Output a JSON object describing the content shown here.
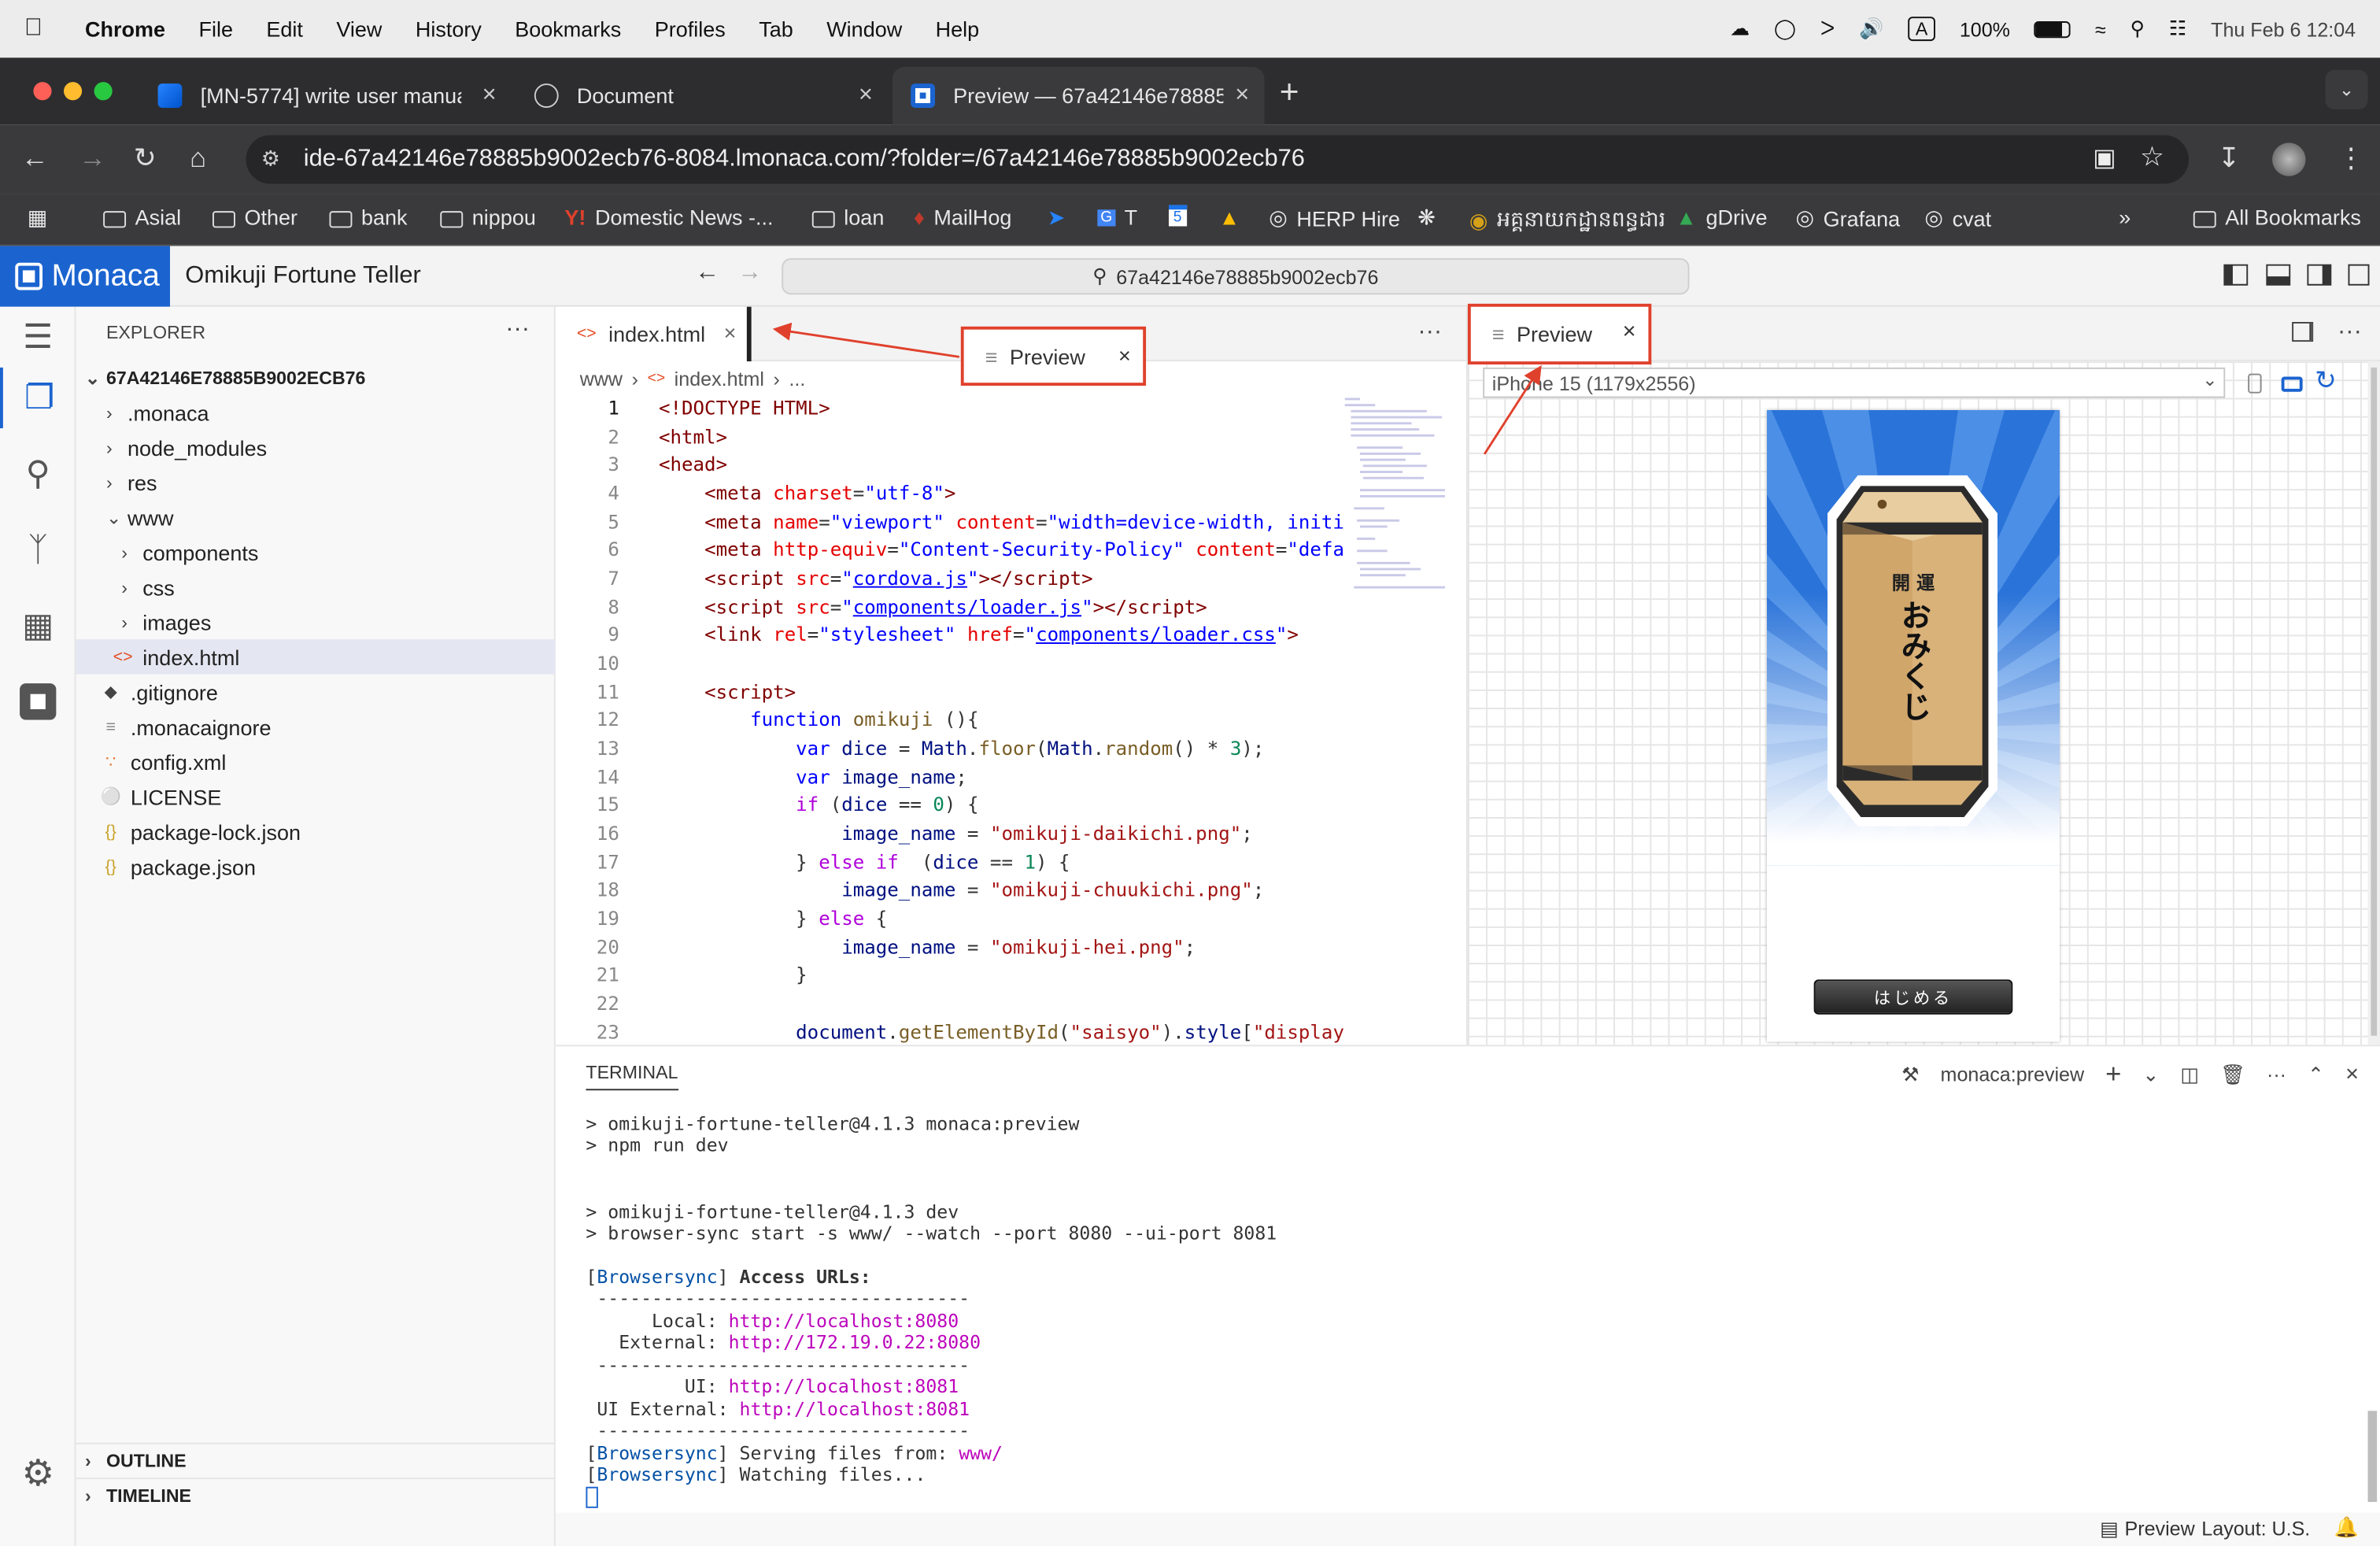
{
  "menubar": {
    "apple_icon": "apple-icon",
    "app": "Chrome",
    "items": [
      "File",
      "Edit",
      "View",
      "History",
      "Bookmarks",
      "Profiles",
      "Tab",
      "Window",
      "Help"
    ],
    "battery": "100%",
    "datetime": "Thu Feb 6  12:04"
  },
  "tabs": [
    {
      "title": "[MN-5774] write user manual",
      "favicon": "jira-icon",
      "active": false
    },
    {
      "title": "Document",
      "favicon": "globe-icon",
      "active": false
    },
    {
      "title": "Preview — 67a42146e78885b",
      "favicon": "monaca-icon",
      "active": true
    }
  ],
  "address": {
    "url": "ide-67a42146e78885b9002ecb76-8084.lmonaca.com/?folder=/67a42146e78885b9002ecb76"
  },
  "bookmarks": {
    "items": [
      "Asial",
      "Other",
      "bank",
      "nippou",
      "Domestic News -...",
      "loan",
      "MailHog",
      "T",
      "HERP Hire",
      "អគ្គនាយកដ្ឋានពន្ធដារ",
      "gDrive",
      "Grafana",
      "cvat"
    ],
    "more": "»",
    "all": "All Bookmarks"
  },
  "ide": {
    "logo": "Monaca",
    "project": "Omikuji Fortune Teller",
    "command_center": "67a42146e78885b9002ecb76"
  },
  "explorer": {
    "title": "EXPLORER",
    "root": "67A42146E78885B9002ECB76",
    "items": [
      ".monaca",
      "node_modules",
      "res",
      "www",
      "components",
      "css",
      "images",
      "index.html",
      ".gitignore",
      ".monacaignore",
      "config.xml",
      "LICENSE",
      "package-lock.json",
      "package.json"
    ],
    "outline": "OUTLINE",
    "timeline": "TIMELINE"
  },
  "editor": {
    "tab": "index.html",
    "breadcrumb": [
      "www",
      "index.html",
      "..."
    ],
    "line_numbers": [
      "1",
      "2",
      "3",
      "4",
      "5",
      "6",
      "7",
      "8",
      "9",
      "10",
      "11",
      "12",
      "13",
      "14",
      "15",
      "16",
      "17",
      "18",
      "19",
      "20",
      "21",
      "22",
      "23"
    ]
  },
  "annotation": {
    "floating_tab": "Preview"
  },
  "preview": {
    "tab": "Preview",
    "device": "iPhone 15 (1179x2556)",
    "box_top": "開 運",
    "box_main": "おみくじ",
    "start_button": "はじめる"
  },
  "terminal": {
    "title": "TERMINAL",
    "task": "monaca:preview",
    "l1": "> omikuji-fortune-teller@4.1.3 monaca:preview",
    "l2": "> npm run dev",
    "l3": "> omikuji-fortune-teller@4.1.3 dev",
    "l4": "> browser-sync start -s www/ --watch --port 8080 --ui-port 8081",
    "bs": "Browsersync",
    "access": "Access URLs:",
    "rule": " ----------------------------------",
    "local_label": "      Local: ",
    "local_url": "http://localhost:8080",
    "ext_label": "   External: ",
    "ext_url": "http://172.19.0.22:8080",
    "ui_label": "         UI: ",
    "ui_url": "http://localhost:8081",
    "uiext_label": " UI External: ",
    "uiext_url": "http://localhost:8081",
    "serving": " Serving files from: ",
    "serving_dir": "www/",
    "watching": " Watching files..."
  },
  "status": {
    "preview": "Preview",
    "layout": "Layout: U.S."
  },
  "colors": {
    "monaca_blue": "#1b64d0",
    "annotation_red": "#e0412c"
  }
}
